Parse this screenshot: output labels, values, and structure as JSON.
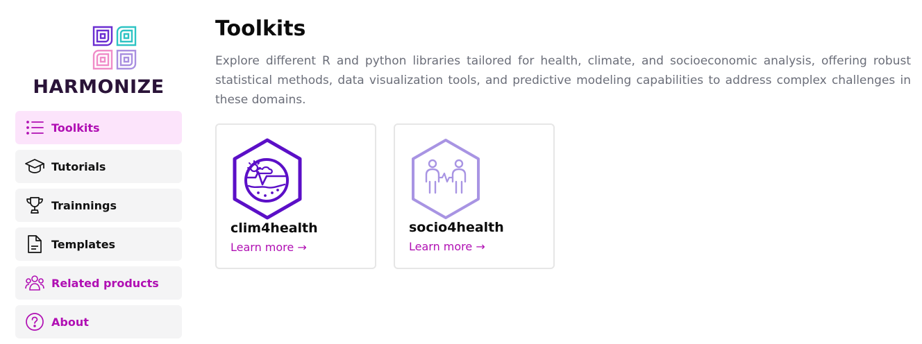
{
  "brand": {
    "name": "HARMONIZE"
  },
  "sidebar": {
    "items": [
      {
        "label": "Toolkits",
        "icon": "list-icon",
        "state": "active"
      },
      {
        "label": "Tutorials",
        "icon": "graduation-cap-icon"
      },
      {
        "label": "Trainnings",
        "icon": "trophy-icon"
      },
      {
        "label": "Templates",
        "icon": "document-icon"
      },
      {
        "label": "Related products",
        "icon": "users-icon"
      },
      {
        "label": "About",
        "icon": "question-circle-icon"
      }
    ]
  },
  "main": {
    "title": "Toolkits",
    "description": "Explore different R and python libraries tailored for health, climate, and socioeconomic analysis, offering robust statistical methods, data visualization tools, and predictive modeling capabilities to address complex challenges in these domains.",
    "cards": [
      {
        "name": "clim4health",
        "link": "Learn more →",
        "icon": "climate-health-hex-icon"
      },
      {
        "name": "socio4health",
        "link": "Learn more →",
        "icon": "socio-health-hex-icon"
      }
    ]
  },
  "colors": {
    "accent": "#b00fb3",
    "active_bg": "#fce4fb",
    "nav_bg": "#f4f4f5",
    "clim_purple": "#5b0fc7",
    "socio_lavender": "#a894e3",
    "logo_purple": "#6a2ed1",
    "logo_teal": "#2ec4c4",
    "logo_pink": "#f08cc8",
    "logo_lilac": "#a98fe0",
    "wordmark": "#2a1338"
  }
}
